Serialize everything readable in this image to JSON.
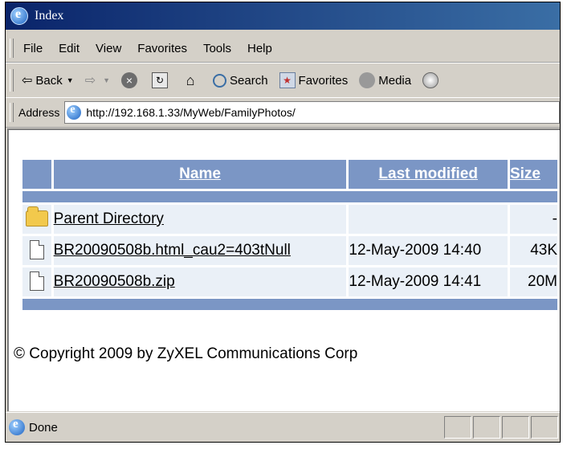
{
  "window": {
    "title": "Index"
  },
  "menu": {
    "items": [
      "File",
      "Edit",
      "View",
      "Favorites",
      "Tools",
      "Help"
    ]
  },
  "toolbar": {
    "back_label": "Back",
    "search_label": "Search",
    "favorites_label": "Favorites",
    "media_label": "Media"
  },
  "address": {
    "label": "Address",
    "url": "http://192.168.1.33/MyWeb/FamilyPhotos/"
  },
  "listing": {
    "headers": {
      "name": "Name",
      "last_modified": "Last modified",
      "size": "Size"
    },
    "rows": [
      {
        "icon": "folder-icon",
        "name": "Parent Directory",
        "modified": "",
        "size": "-"
      },
      {
        "icon": "file-icon",
        "name": "BR20090508b.html_cau2=403tNull",
        "modified": "12-May-2009 14:40",
        "size": "43K"
      },
      {
        "icon": "file-icon",
        "name": "BR20090508b.zip",
        "modified": "12-May-2009 14:41",
        "size": "20M"
      }
    ]
  },
  "footer": {
    "copyright": "© Copyright 2009 by ZyXEL Communications Corp"
  },
  "status": {
    "text": "Done"
  },
  "colors": {
    "header_bg": "#7b96c5",
    "row_bg": "#eaf0f7",
    "titlebar": "#0a246a"
  }
}
